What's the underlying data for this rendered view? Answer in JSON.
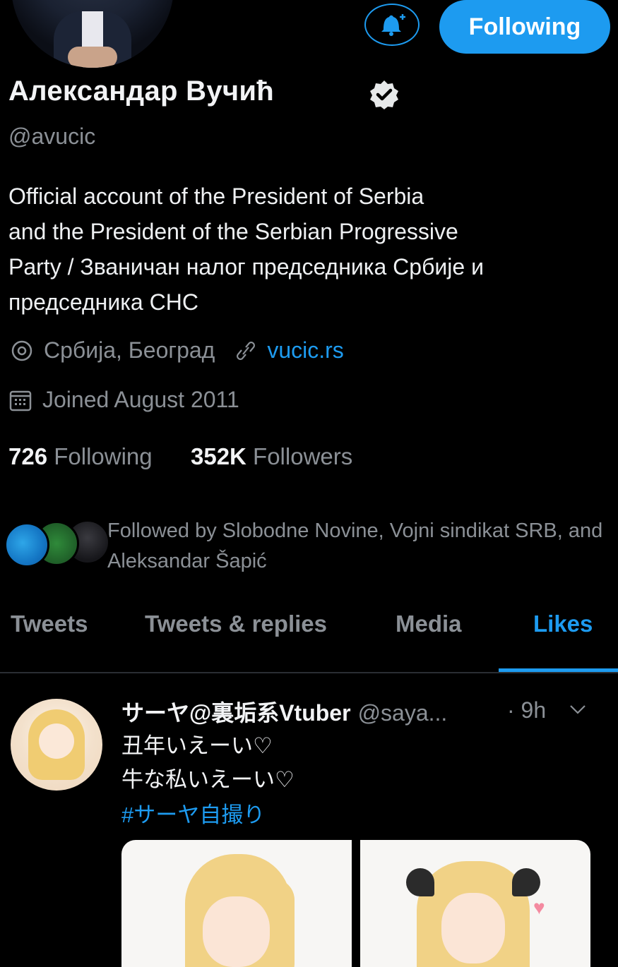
{
  "profile": {
    "display_name": "Александар Вучић",
    "handle": "@avucic",
    "bio": "Official account of the President of Serbia\nand the President of the Serbian Progressive\nParty / Званичан налог председника Србије и\nпредседника СНС",
    "location": "Србија, Београд",
    "website": "vucic.rs",
    "joined": "Joined August 2011",
    "following_count": "726",
    "following_label": "Following",
    "followers_count": "352K",
    "followers_label": "Followers",
    "followed_by": "Followed by Slobodne Novine, Vojni sindikat SRB, and Aleksandar Šapić"
  },
  "actions": {
    "follow_button": "Following",
    "notification_icon": "bell-plus-icon"
  },
  "tabs": [
    {
      "label": "Tweets",
      "active": false
    },
    {
      "label": "Tweets & replies",
      "active": false
    },
    {
      "label": "Media",
      "active": false
    },
    {
      "label": "Likes",
      "active": true
    }
  ],
  "tweet": {
    "author": "サーヤ@裏垢系Vtuber",
    "handle": "@saya...",
    "time": "· 9h",
    "lines": "丑年いえーい♡\n牛な私いえーい♡",
    "hashtag": "#サーヤ自撮り"
  },
  "colors": {
    "accent": "#1d9bf0",
    "background": "#000000",
    "muted": "#8b9096"
  }
}
